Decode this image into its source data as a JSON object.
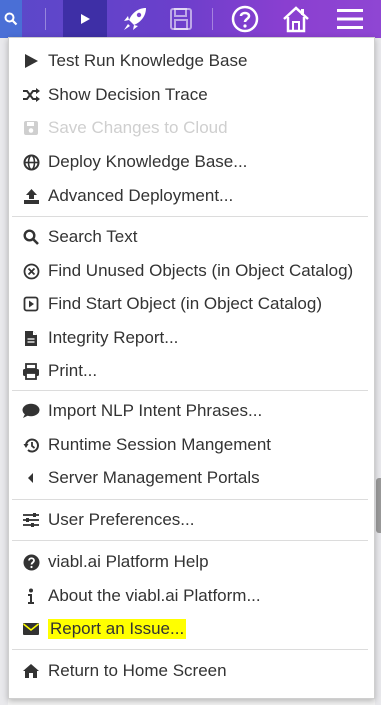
{
  "colors": {
    "toolbar_start": "#5a49c9",
    "toolbar_end": "#8f46d3",
    "highlight": "#ffff00",
    "text": "#333333",
    "disabled": "#cfcfcf"
  },
  "toolbar": {
    "icons": [
      "search-icon",
      "play-icon",
      "rocket-icon",
      "save-icon",
      "help-icon",
      "home-icon",
      "hamburger-menu-icon"
    ]
  },
  "menu": {
    "items": [
      {
        "label": "Test Run Knowledge Base",
        "icon": "play-icon"
      },
      {
        "label": "Show Decision Trace",
        "icon": "shuffle-icon"
      },
      {
        "label": "Save Changes to Cloud",
        "icon": "save-icon",
        "disabled": true
      },
      {
        "label": "Deploy Knowledge Base...",
        "icon": "globe-icon"
      },
      {
        "label": "Advanced Deployment...",
        "icon": "upload-icon"
      },
      {
        "label": "Search Text",
        "icon": "search-icon"
      },
      {
        "label": "Find Unused Objects (in Object Catalog)",
        "icon": "circle-x-icon"
      },
      {
        "label": "Find Start Object (in Object Catalog)",
        "icon": "square-caret-icon"
      },
      {
        "label": "Integrity Report...",
        "icon": "file-icon"
      },
      {
        "label": "Print...",
        "icon": "print-icon"
      },
      {
        "label": "Import NLP Intent Phrases...",
        "icon": "comment-icon"
      },
      {
        "label": "Runtime Session Mangement",
        "icon": "history-icon"
      },
      {
        "label": "Server Management Portals",
        "icon": "caret-left-icon"
      },
      {
        "label": "User Preferences...",
        "icon": "sliders-icon"
      },
      {
        "label": "viabl.ai Platform Help",
        "icon": "question-circle-icon"
      },
      {
        "label": "About the viabl.ai Platform...",
        "icon": "info-icon"
      },
      {
        "label": "Report an Issue...",
        "icon": "envelope-icon",
        "highlighted": true
      },
      {
        "label": "Return to Home Screen",
        "icon": "home-icon"
      }
    ]
  }
}
